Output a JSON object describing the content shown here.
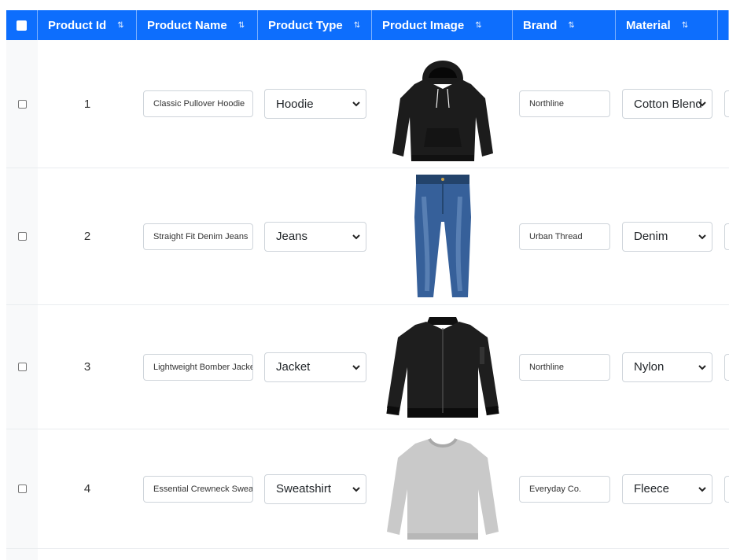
{
  "header": {
    "columns": [
      {
        "label": "Product Id",
        "sort_glyph": "⇅"
      },
      {
        "label": "Product Name",
        "sort_glyph": "⇅"
      },
      {
        "label": "Product Type",
        "sort_glyph": "⇅"
      },
      {
        "label": "Product Image",
        "sort_glyph": "⇅"
      },
      {
        "label": "Brand",
        "sort_glyph": "⇅"
      },
      {
        "label": "Material",
        "sort_glyph": "⇅"
      }
    ]
  },
  "rows": [
    {
      "id": "1",
      "name": "Classic Pullover Hoodie",
      "type": "Hoodie",
      "image": "black-hoodie-image",
      "brand": "Northline",
      "material": "Cotton Blend"
    },
    {
      "id": "2",
      "name": "Straight Fit Denim Jeans",
      "type": "Jeans",
      "image": "blue-denim-jeans-image",
      "brand": "Urban Thread",
      "material": "Denim"
    },
    {
      "id": "3",
      "name": "Lightweight Bomber Jacket",
      "type": "Jacket",
      "image": "black-bomber-jacket-image",
      "brand": "Northline",
      "material": "Nylon"
    },
    {
      "id": "4",
      "name": "Essential Crewneck Sweatshirt",
      "type": "Sweatshirt",
      "image": "gray-crewneck-sweatshirt-image",
      "brand": "Everyday Co.",
      "material": "Fleece"
    }
  ],
  "colors": {
    "header_bg": "#0d6efd",
    "header_text": "#ffffff",
    "row_border": "#e9ecef",
    "select_col_bg": "#f8f9fa"
  }
}
